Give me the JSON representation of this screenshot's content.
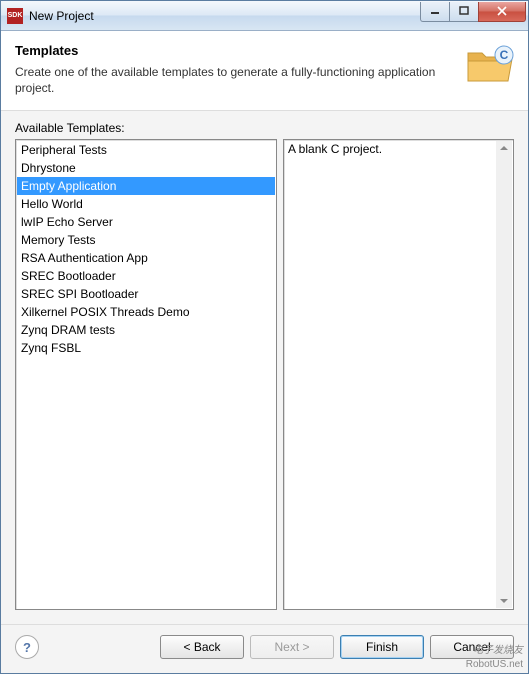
{
  "window": {
    "title": "New Project",
    "icon_text": "SDK"
  },
  "header": {
    "title": "Templates",
    "description": "Create one of the available templates to generate a fully-functioning application project."
  },
  "available_label": "Available Templates:",
  "templates": [
    {
      "label": "Peripheral Tests",
      "selected": false
    },
    {
      "label": "Dhrystone",
      "selected": false
    },
    {
      "label": "Empty Application",
      "selected": true
    },
    {
      "label": "Hello World",
      "selected": false
    },
    {
      "label": "lwIP Echo Server",
      "selected": false
    },
    {
      "label": "Memory Tests",
      "selected": false
    },
    {
      "label": "RSA Authentication App",
      "selected": false
    },
    {
      "label": "SREC Bootloader",
      "selected": false
    },
    {
      "label": "SREC SPI Bootloader",
      "selected": false
    },
    {
      "label": "Xilkernel POSIX Threads Demo",
      "selected": false
    },
    {
      "label": "Zynq DRAM tests",
      "selected": false
    },
    {
      "label": "Zynq FSBL",
      "selected": false
    }
  ],
  "description_panel": "A blank C project.",
  "buttons": {
    "back": "< Back",
    "next": "Next >",
    "finish": "Finish",
    "cancel": "Cancel",
    "help": "?"
  },
  "watermarks": {
    "w1": "电子发烧友",
    "w2": "RobotUS.net"
  }
}
